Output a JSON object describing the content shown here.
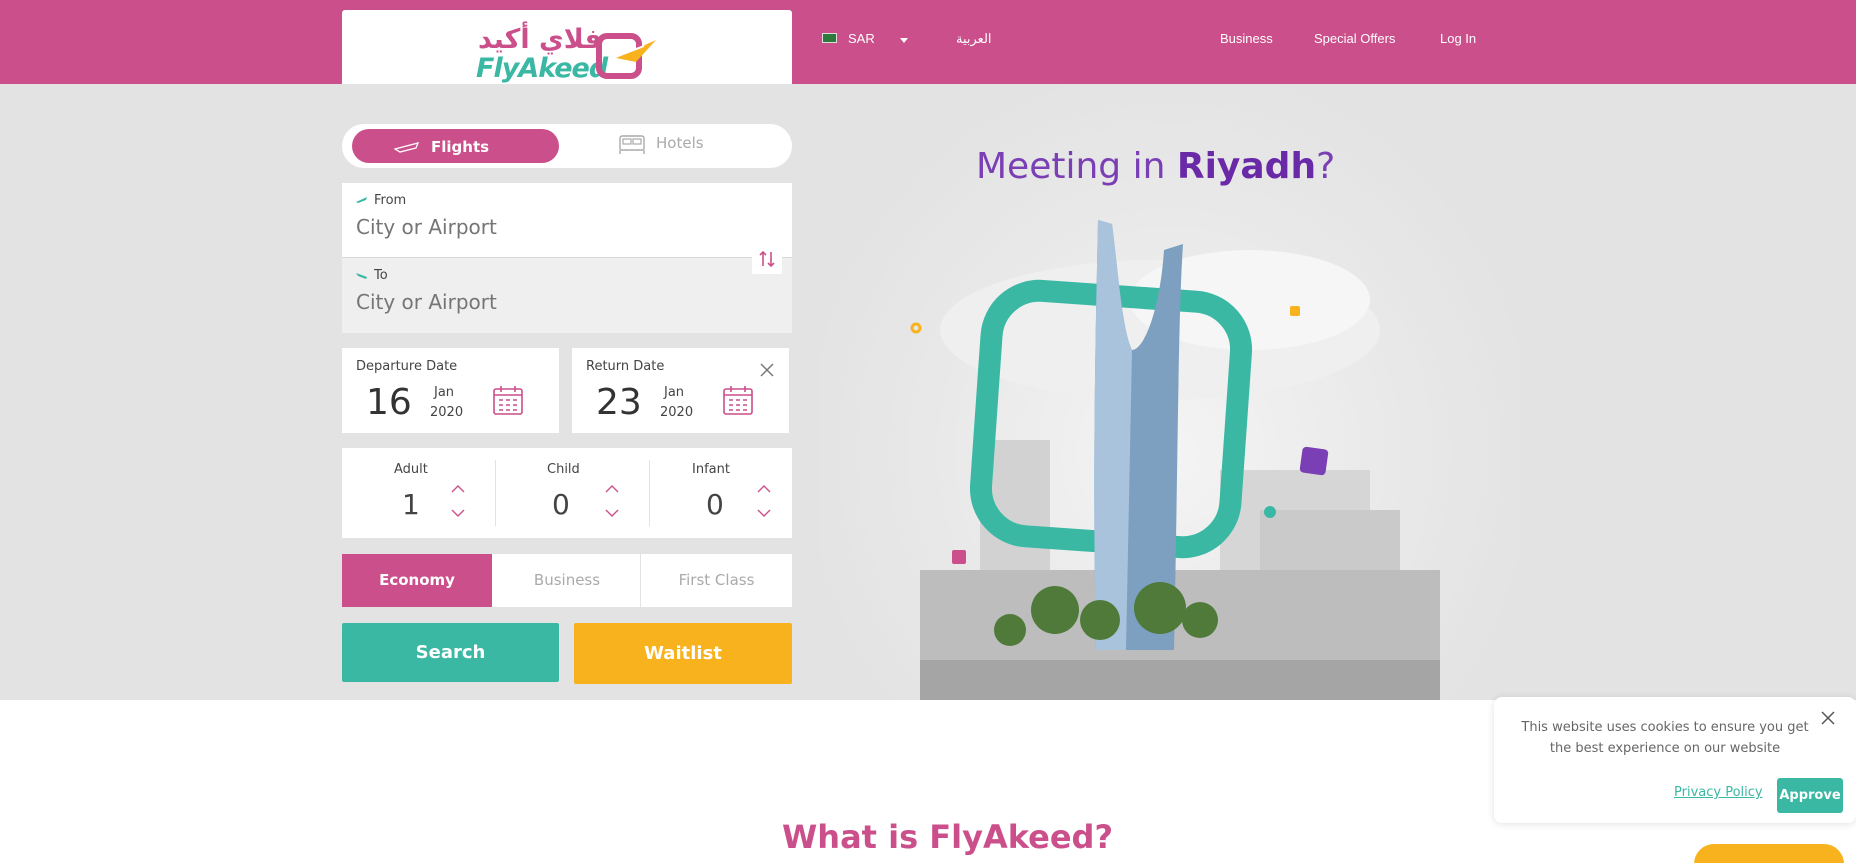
{
  "header": {
    "logo_arabic": "فلاي أكيد",
    "logo_english": "FlyAkeed",
    "currency": "SAR",
    "language": "العربية",
    "nav": [
      {
        "label": "Business"
      },
      {
        "label": "Special Offers"
      },
      {
        "label": "Log In"
      }
    ]
  },
  "search": {
    "tabs": [
      {
        "label": "Flights",
        "active": true
      },
      {
        "label": "Hotels",
        "active": false
      }
    ],
    "from": {
      "label": "From",
      "placeholder": "City or Airport"
    },
    "to": {
      "label": "To",
      "placeholder": "City or Airport"
    },
    "departure": {
      "label": "Departure Date",
      "day": "16",
      "month": "Jan",
      "year": "2020"
    },
    "return": {
      "label": "Return Date",
      "day": "23",
      "month": "Jan",
      "year": "2020"
    },
    "passengers": [
      {
        "label": "Adult",
        "value": "1"
      },
      {
        "label": "Child",
        "value": "0"
      },
      {
        "label": "Infant",
        "value": "0"
      }
    ],
    "cabin_classes": [
      {
        "label": "Economy",
        "active": true
      },
      {
        "label": "Business",
        "active": false
      },
      {
        "label": "First Class",
        "active": false
      }
    ],
    "search_button": "Search",
    "waitlist_button": "Waitlist"
  },
  "hero": {
    "headline_prefix": "Meeting in",
    "headline_city": "Riyadh",
    "headline_suffix": "?"
  },
  "section": {
    "title": "What is FlyAkeed?"
  },
  "cookie": {
    "text": "This website uses cookies to ensure you get the best experience on our website",
    "privacy_link": "Privacy Policy",
    "approve_button": "Approve"
  },
  "colors": {
    "brand_pink": "#cb4f8a",
    "brand_teal": "#3ab8a4",
    "brand_yellow": "#f8b21d",
    "brand_purple": "#7b3fb5"
  }
}
